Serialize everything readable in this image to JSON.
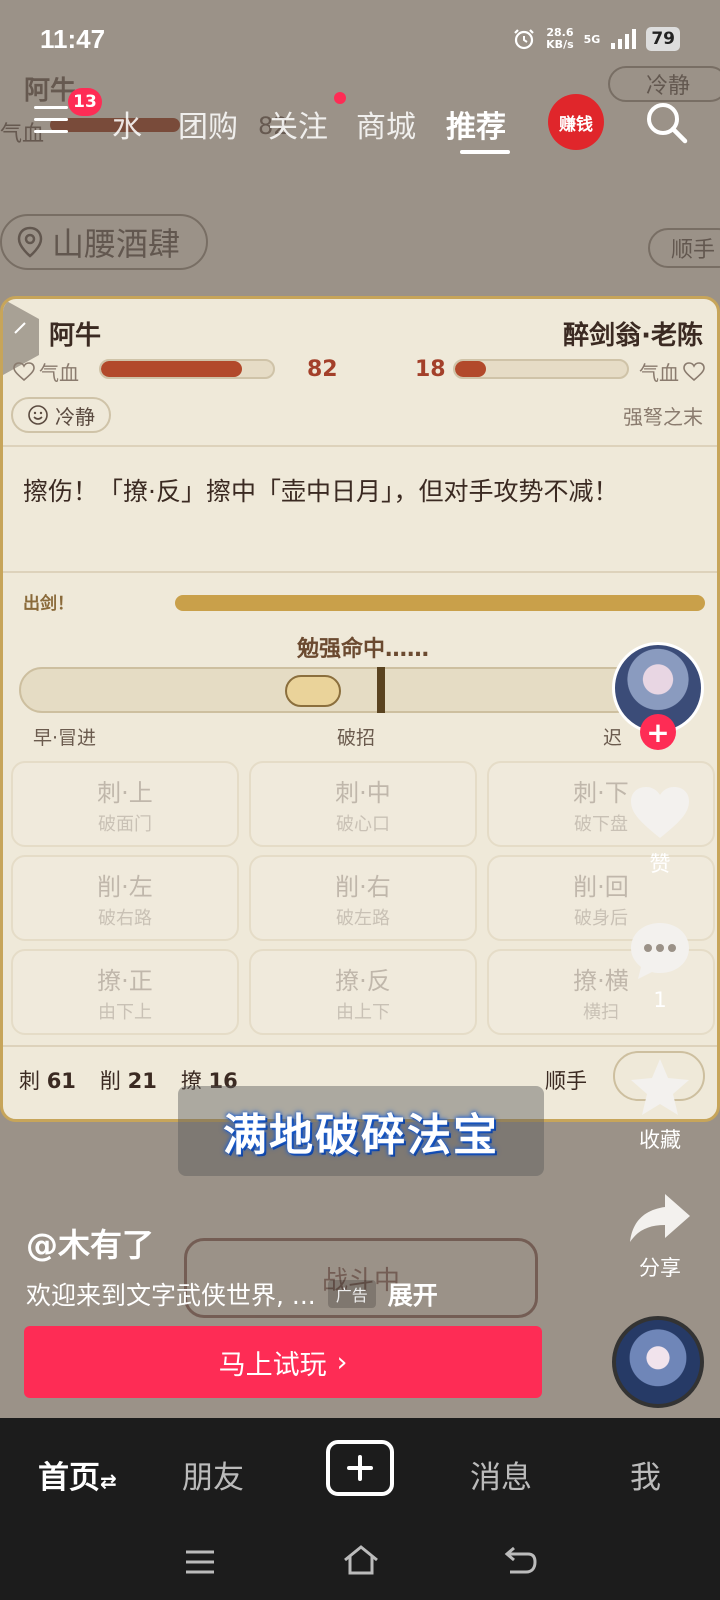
{
  "status_bar": {
    "time": "11:47",
    "net_speed_value": "28.6",
    "net_speed_unit": "KB/s",
    "network": "5G",
    "battery": "79"
  },
  "top_nav": {
    "badge": "13",
    "tabs": [
      "同城水",
      "团购",
      "关注",
      "商城",
      "推荐"
    ],
    "tab_partial": "水",
    "active_tab": "推荐",
    "earn_label": "赚钱"
  },
  "background": {
    "name": "阿牛",
    "hp_label": "气血",
    "hp_value": "82",
    "mood": "冷静",
    "location": "山腰酒肆",
    "side_pill": "顺手",
    "battle_button": "战斗中"
  },
  "game": {
    "player": {
      "name": "阿牛",
      "hp_label": "气血",
      "hp": "82",
      "hp_fraction": 0.82,
      "mood": "冷静"
    },
    "enemy": {
      "name": "醉剑翁·老陈",
      "hp_label": "气血",
      "hp": "18",
      "hp_fraction": 0.18,
      "state": "强弩之末"
    },
    "narration": "擦伤！「撩·反」擦中「壶中日月」，但对手攻势不减！",
    "out_label": "出剑！",
    "hit_text": "勉强命中……",
    "slider_labels": {
      "left": "早·冒进",
      "center": "破招",
      "right": "迟"
    },
    "moves": [
      {
        "name": "刺·上",
        "sub": "破面门"
      },
      {
        "name": "刺·中",
        "sub": "破心口"
      },
      {
        "name": "刺·下",
        "sub": "破下盘"
      },
      {
        "name": "削·左",
        "sub": "破右路"
      },
      {
        "name": "削·右",
        "sub": "破左路"
      },
      {
        "name": "削·回",
        "sub": "破身后"
      },
      {
        "name": "撩·正",
        "sub": "由下上"
      },
      {
        "name": "撩·反",
        "sub": "由上下"
      },
      {
        "name": "撩·横",
        "sub": "横扫"
      }
    ],
    "stats": [
      {
        "label": "刺",
        "value": "61"
      },
      {
        "label": "削",
        "value": "21"
      },
      {
        "label": "撩",
        "value": "16"
      }
    ],
    "shunshou": "顺手"
  },
  "subtitle": "满地破碎法宝",
  "post": {
    "author": "@木有了",
    "description": "欢迎来到文字武侠世界, ...",
    "ad_tag": "广告",
    "expand": "展开",
    "cta": "马上试玩",
    "cta_arrow": "›"
  },
  "rail": {
    "follow": "+",
    "like_label": "赞",
    "comment_count": "1",
    "favorite_label": "收藏",
    "share_label": "分享"
  },
  "bottom_nav": {
    "items": [
      "首页",
      "朋友",
      "消息",
      "我"
    ],
    "home_suffix": "⇄"
  },
  "colors": {
    "accent": "#fe2c55",
    "hp_fill": "#b2492b",
    "gold": "#c9a04a",
    "card_bg": "#efe9d9"
  },
  "icons": [
    "menu-icon",
    "search-icon",
    "location-pin-icon",
    "heart-icon",
    "comment-icon",
    "star-icon",
    "share-icon",
    "smile-icon",
    "plus-icon",
    "system-menu-icon",
    "system-home-icon",
    "system-back-icon",
    "alarm-icon",
    "signal-icon"
  ]
}
